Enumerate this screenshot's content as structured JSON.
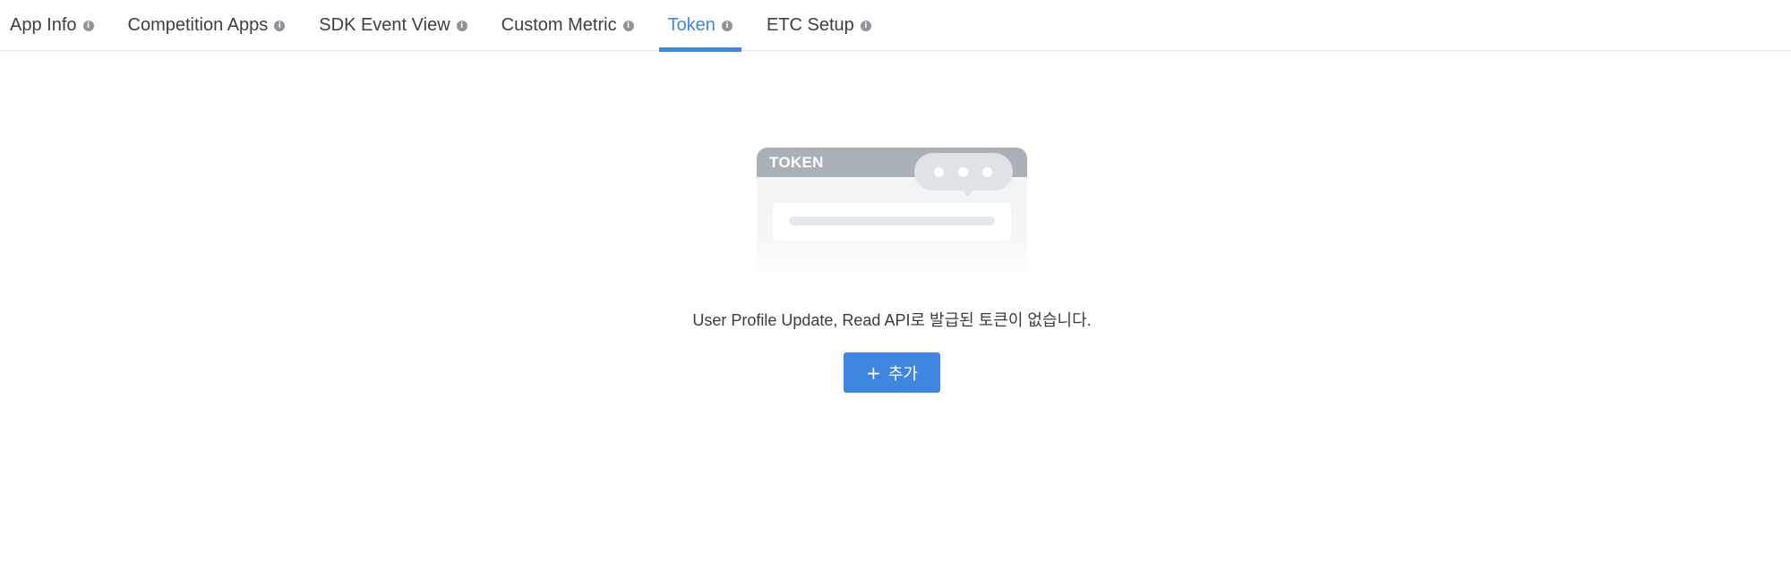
{
  "tabs": [
    {
      "label": "App Info",
      "active": false
    },
    {
      "label": "Competition Apps",
      "active": false
    },
    {
      "label": "SDK Event View",
      "active": false
    },
    {
      "label": "Custom Metric",
      "active": false
    },
    {
      "label": "Token",
      "active": true
    },
    {
      "label": "ETC Setup",
      "active": false
    }
  ],
  "info_icon": "info-icon",
  "empty_state": {
    "illustration_label": "TOKEN",
    "message": "User Profile Update, Read API로 발급된 토큰이 없습니다.",
    "add_button_label": "추가",
    "add_button_icon": "+"
  },
  "colors": {
    "accent": "#3f86e0",
    "tab_text": "#3c4043",
    "info_icon": "#8f949b"
  }
}
